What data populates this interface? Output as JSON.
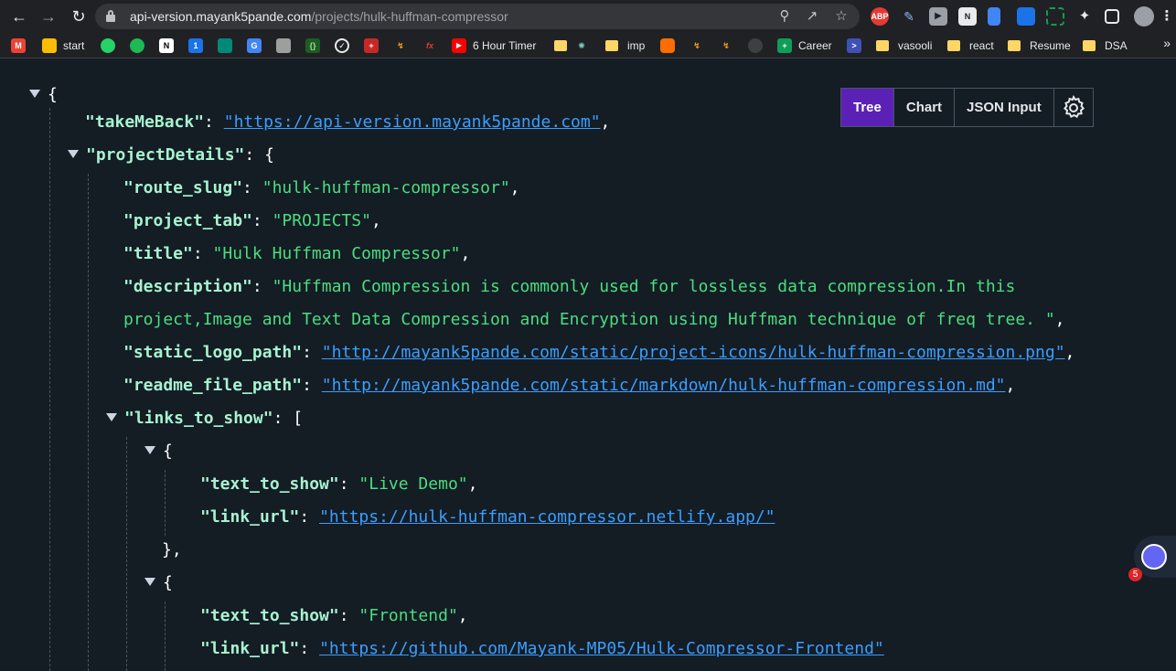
{
  "browser": {
    "url_host": "api-version.mayank5pande.com",
    "url_path": "/projects/hulk-huffman-compressor",
    "extensions": [
      {
        "name": "adblock-plus",
        "label": "ABP",
        "color": "#e53935"
      },
      {
        "name": "pen-extension",
        "label": "",
        "color": "#5f6368"
      },
      {
        "name": "media-extension",
        "label": "",
        "color": "#5f6368"
      },
      {
        "name": "notion-extension",
        "label": "N",
        "color": "#5f6368"
      },
      {
        "name": "doc-extension",
        "label": "",
        "color": "#4285f4"
      },
      {
        "name": "reader-extension",
        "label": "",
        "color": "#1a73e8"
      },
      {
        "name": "screenshot-extension",
        "label": "",
        "color": "#0f9d58"
      }
    ]
  },
  "bookmarks": [
    {
      "label": "",
      "icon": "gmail-icon",
      "color": "#ea4335",
      "glyph": "M"
    },
    {
      "label": "start",
      "icon": "start-icon",
      "color": "#fbbc04",
      "glyph": ""
    },
    {
      "label": "",
      "icon": "whatsapp-icon",
      "color": "#25d366",
      "glyph": ""
    },
    {
      "label": "",
      "icon": "spotify-icon",
      "color": "#1db954",
      "glyph": ""
    },
    {
      "label": "",
      "icon": "notion-icon",
      "color": "#ffffff",
      "glyph": "N"
    },
    {
      "label": "",
      "icon": "calendar-icon",
      "color": "#1a73e8",
      "glyph": "1"
    },
    {
      "label": "",
      "icon": "meet-icon",
      "color": "#00897b",
      "glyph": ""
    },
    {
      "label": "",
      "icon": "sheets-icon",
      "color": "#4285f4",
      "glyph": "G"
    },
    {
      "label": "",
      "icon": "profile-icon",
      "color": "#9e9e9e",
      "glyph": ""
    },
    {
      "label": "",
      "icon": "code-icon",
      "color": "#2e7d32",
      "glyph": "{}"
    },
    {
      "label": "",
      "icon": "check-icon",
      "color": "#202124",
      "glyph": "✓"
    },
    {
      "label": "",
      "icon": "cross-icon",
      "color": "#c62828",
      "glyph": "+"
    },
    {
      "label": "",
      "icon": "leetcode-icon",
      "color": "#202124",
      "glyph": ""
    },
    {
      "label": "",
      "icon": "fx-icon",
      "color": "#202124",
      "glyph": "fx"
    },
    {
      "label": "6 Hour Timer",
      "icon": "youtube-icon",
      "color": "#ff0000",
      "glyph": "▶"
    },
    {
      "label": "",
      "icon": "folder-icon",
      "color": "#fdd663",
      "glyph": ""
    },
    {
      "label": "",
      "icon": "chrome-dino-icon",
      "color": "#202124",
      "glyph": ""
    },
    {
      "label": "imp",
      "icon": "folder-icon",
      "color": "#fdd663",
      "glyph": ""
    },
    {
      "label": "",
      "icon": "hexagon-icon",
      "color": "#ff6d00",
      "glyph": ""
    },
    {
      "label": "",
      "icon": "leetcode-icon",
      "color": "#202124",
      "glyph": ""
    },
    {
      "label": "",
      "icon": "leetcode-icon",
      "color": "#202124",
      "glyph": ""
    },
    {
      "label": "",
      "icon": "github-icon",
      "color": "#3c4043",
      "glyph": ""
    },
    {
      "label": "Career",
      "icon": "sheets-icon",
      "color": "#0f9d58",
      "glyph": "+"
    },
    {
      "label": "",
      "icon": "terminal-icon",
      "color": "#3f51b5",
      "glyph": ">"
    },
    {
      "label": "vasooli",
      "icon": "folder-icon",
      "color": "#fdd663",
      "glyph": ""
    },
    {
      "label": "react",
      "icon": "folder-icon",
      "color": "#fdd663",
      "glyph": ""
    },
    {
      "label": "Resume",
      "icon": "folder-icon",
      "color": "#fdd663",
      "glyph": ""
    },
    {
      "label": "DSA",
      "icon": "folder-icon",
      "color": "#fdd663",
      "glyph": ""
    }
  ],
  "tabs": {
    "tree": "Tree",
    "chart": "Chart",
    "json_input": "JSON Input"
  },
  "json": {
    "open_brace": "{",
    "takeMeBack_key": "\"takeMeBack\"",
    "takeMeBack_value": "\"https://api-version.mayank5pande.com\"",
    "projectDetails_key": "\"projectDetails\"",
    "route_slug_key": "\"route_slug\"",
    "route_slug_value": "\"hulk-huffman-compressor\"",
    "project_tab_key": "\"project_tab\"",
    "project_tab_value": "\"PROJECTS\"",
    "title_key": "\"title\"",
    "title_value": "\"Hulk Huffman Compressor\"",
    "description_key": "\"description\"",
    "description_value_line1": "\"Huffman Compression is commonly used for lossless data compression.In this",
    "description_value_line2": "project,Image and Text Data Compression and Encryption using Huffman technique of freq tree. \"",
    "static_logo_path_key": "\"static_logo_path\"",
    "static_logo_path_value": "\"http://mayank5pande.com/static/project-icons/hulk-huffman-compression.png\"",
    "readme_file_path_key": "\"readme_file_path\"",
    "readme_file_path_value": "\"http://mayank5pande.com/static/markdown/hulk-huffman-compression.md\"",
    "links_to_show_key": "\"links_to_show\"",
    "links": [
      {
        "text_to_show_key": "\"text_to_show\"",
        "text_to_show_value": "\"Live Demo\"",
        "link_url_key": "\"link_url\"",
        "link_url_value": "\"https://hulk-huffman-compressor.netlify.app/\""
      },
      {
        "text_to_show_key": "\"text_to_show\"",
        "text_to_show_value": "\"Frontend\"",
        "link_url_key": "\"link_url\"",
        "link_url_value": "\"https://github.com/Mayank-MP05/Hulk-Compressor-Frontend\""
      }
    ]
  },
  "widget": {
    "badge_count": "5"
  },
  "colors": {
    "background": "#141c24",
    "key": "#a7f3d0",
    "string": "#4ade80",
    "link": "#3b9eff",
    "active_tab": "#5b21b6"
  }
}
